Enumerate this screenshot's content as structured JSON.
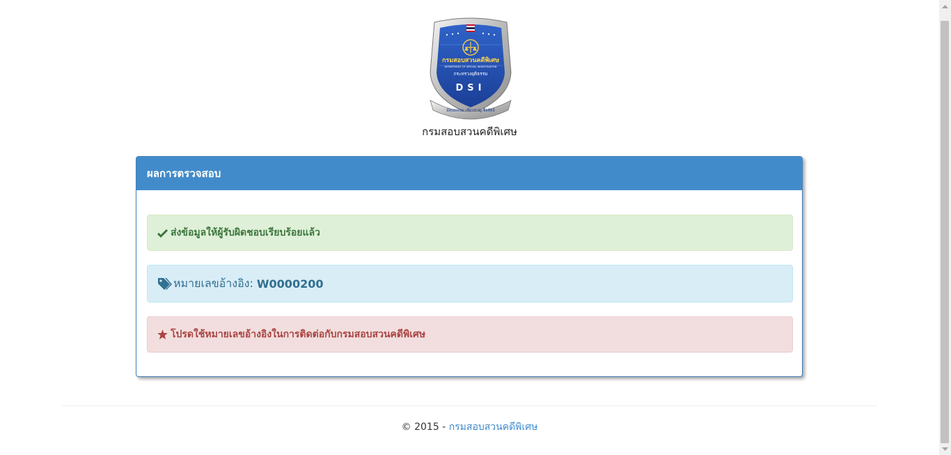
{
  "header": {
    "logo": {
      "dept_name_th": "กรมสอบสวนคดีพิเศษ",
      "dept_name_en": "DEPARTMENT OF SPECIAL INVESTIGATION",
      "ministry_th": "กระทรวงยุติธรรม",
      "abbrev": "DSI",
      "motto": "มีคุณธรรม  เชี่ยวชาญ  ซื่อสัตย์"
    },
    "org_title": "กรมสอบสวนคดีพิเศษ"
  },
  "panel": {
    "title": "ผลการตรวจสอบ",
    "success_message": "ส่งข้อมูลให้ผู้รับผิดชอบเรียบร้อยแล้ว",
    "reference_label": "หมายเลขอ้างอิง:",
    "reference_value": "W0000200",
    "notice_message": "โปรดใช้หมายเลขอ้างอิงในการติดต่อกับกรมสอบสวนคดีพิเศษ"
  },
  "footer": {
    "copyright": "© 2015 - ",
    "link_text": "กรมสอบสวนคดีพิเศษ"
  },
  "icons": {
    "success": "check-icon",
    "reference": "tags-icon",
    "notice": "star-icon"
  },
  "colors": {
    "primary": "#428bca",
    "success_text": "#3c763d",
    "info_text": "#31708f",
    "danger_text": "#a94442"
  }
}
